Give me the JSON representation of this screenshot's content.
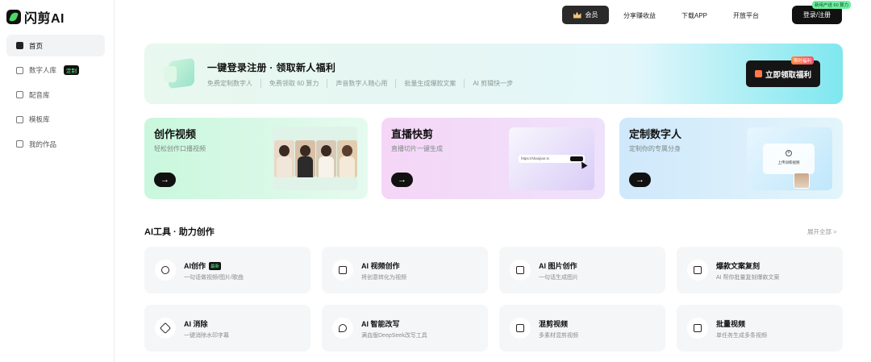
{
  "app": {
    "name": "闪剪AI"
  },
  "sidebar": {
    "items": [
      {
        "label": "首页",
        "active": true
      },
      {
        "label": "数字人库",
        "tag": "定制"
      },
      {
        "label": "配音库"
      },
      {
        "label": "模板库"
      },
      {
        "label": "我的作品"
      }
    ]
  },
  "header": {
    "vip_label": "会员",
    "links": [
      "分享赚收益",
      "下载APP",
      "开放平台"
    ],
    "login_label": "登录/注册",
    "login_badge": "新用户送 60 算力"
  },
  "banner": {
    "title": "一键登录注册 · 领取新人福利",
    "items": [
      "免费定制数字人",
      "免费领取 60 算力",
      "声音数字人随心用",
      "批量生成爆款文案",
      "AI 剪辑快一步"
    ],
    "button_label": "立即领取福利",
    "button_tag": "限时福利"
  },
  "features": [
    {
      "title": "创作视频",
      "subtitle": "轻松创作口播视频"
    },
    {
      "title": "直播快剪",
      "subtitle": "直播切片一键生成",
      "url_text": "https://shanjian.tv"
    },
    {
      "title": "定制数字人",
      "subtitle": "定制你的专属分身",
      "upload_text": "上传训练视频"
    }
  ],
  "tools_section": {
    "title": "AI工具 · 助力创作",
    "expand_label": "展开全部 >"
  },
  "tools": [
    {
      "title": "AI创作",
      "desc": "一句话做视频/图片/歌曲",
      "tag": "最新"
    },
    {
      "title": "AI 视频创作",
      "desc": "将创意转化为视频"
    },
    {
      "title": "AI 图片创作",
      "desc": "一句话生成图片"
    },
    {
      "title": "爆款文案复刻",
      "desc": "AI 帮你批量复刻爆款文案"
    },
    {
      "title": "AI 消除",
      "desc": "一键消除水印字幕"
    },
    {
      "title": "AI 智能改写",
      "desc": "满血版DeepSeek改写工具"
    },
    {
      "title": "混剪视频",
      "desc": "多素材混剪视频"
    },
    {
      "title": "批量视频",
      "desc": "单任务生成多条视频"
    }
  ],
  "icons": {
    "sidebar": [
      "home-icon",
      "digital-human-icon",
      "dubbing-icon",
      "template-icon",
      "works-icon"
    ],
    "tools": [
      "sparkle-icon",
      "video-create-icon",
      "image-create-icon",
      "text-copy-icon",
      "eraser-icon",
      "rewrite-icon",
      "mix-video-icon",
      "batch-video-icon"
    ]
  },
  "colors": {
    "accent_green": "#5ef08a",
    "dark": "#111111"
  }
}
